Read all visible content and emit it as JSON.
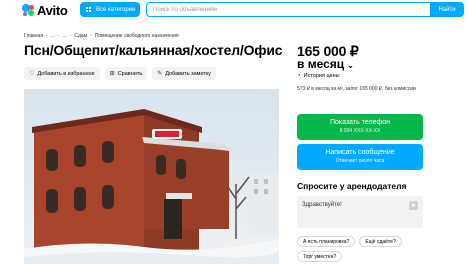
{
  "header": {
    "logo_text": "Avito",
    "categories_label": "Все категории",
    "search_placeholder": "Поиск по объявлениям",
    "search_button": "Найти"
  },
  "breadcrumbs": [
    "Главная",
    "...",
    "...",
    "Сдам",
    "Помещение свободного назначения"
  ],
  "listing": {
    "title": "Псн/Общепит/кальянная/хостел/Офис",
    "actions": [
      {
        "icon": "heart-icon",
        "label": "Добавить в избранное"
      },
      {
        "icon": "compare-icon",
        "label": "Сравнить"
      },
      {
        "icon": "note-icon",
        "label": "Добавить заметку"
      }
    ]
  },
  "price": {
    "amount": "165 000 ₽",
    "period": "в месяц",
    "history_label": "История цены",
    "deposit_text": "573 ₽ в месяц за м², залог 165 000 ₽, без комиссии"
  },
  "contact": {
    "call_label": "Показать телефон",
    "call_sub": "8 934 XXX-XX-XX",
    "message_label": "Написать сообщение",
    "message_sub": "Отвечает около часа"
  },
  "ask": {
    "title": "Спросите у арендодателя",
    "input_value": "Здравствуйте!",
    "chips": [
      "А есть планировка?",
      "Ещё сдаёте?",
      "Торг уместен?"
    ]
  },
  "colors": {
    "accent_blue": "#00aaff",
    "call_green": "#04b84b"
  }
}
